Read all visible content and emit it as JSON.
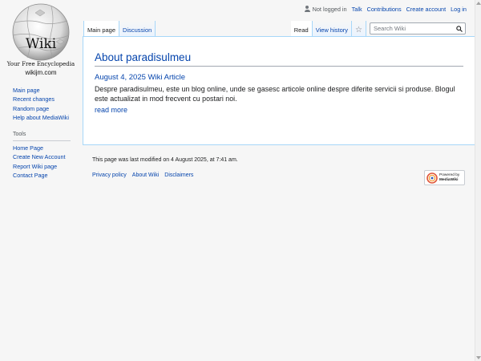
{
  "logo": {
    "wordmark": "Wiki",
    "tagline": "Your Free Encyclopedia",
    "domain": "wikijm.com"
  },
  "personal_tools": {
    "not_logged_in": "Not logged in",
    "talk": "Talk",
    "contributions": "Contributions",
    "create_account": "Create account",
    "log_in": "Log in"
  },
  "tabs": {
    "left": [
      {
        "label": "Main page",
        "selected": true
      },
      {
        "label": "Discussion",
        "selected": false
      }
    ],
    "right": [
      {
        "label": "Read",
        "selected": true
      },
      {
        "label": "View history",
        "selected": false
      }
    ],
    "watch_icon": "star-icon"
  },
  "search": {
    "placeholder": "Search Wiki",
    "button_icon": "magnifier-icon"
  },
  "sidebar": {
    "navigation": [
      {
        "label": "Main page"
      },
      {
        "label": "Recent changes"
      },
      {
        "label": "Random page"
      },
      {
        "label": "Help about MediaWiki"
      }
    ],
    "tools_heading": "Tools",
    "tools": [
      {
        "label": "Home Page"
      },
      {
        "label": "Create New Account"
      },
      {
        "label": "Report Wiki page"
      },
      {
        "label": "Contact Page"
      }
    ]
  },
  "article": {
    "title": "About paradisulmeu",
    "post_date": "August 4, 2025 Wiki Article",
    "body": "Despre paradisulmeu, este un blog online, unde se gasesc articole online despre diferite servicii si produse. Blogul este actualizat in mod frecvent cu postari noi.",
    "read_more": "read more"
  },
  "footer": {
    "last_modified": "This page was last modified on 4 August 2025, at 7:41 am.",
    "links": [
      {
        "label": "Privacy policy"
      },
      {
        "label": "About Wiki"
      },
      {
        "label": "Disclaimers"
      }
    ],
    "powered_by_line1": "Powered by",
    "powered_by_line2": "MediaWiki"
  },
  "colors": {
    "link": "#0645ad",
    "tab_border": "#a7d7f9",
    "page_bg": "#f6f6f6",
    "content_bg": "#ffffff"
  }
}
